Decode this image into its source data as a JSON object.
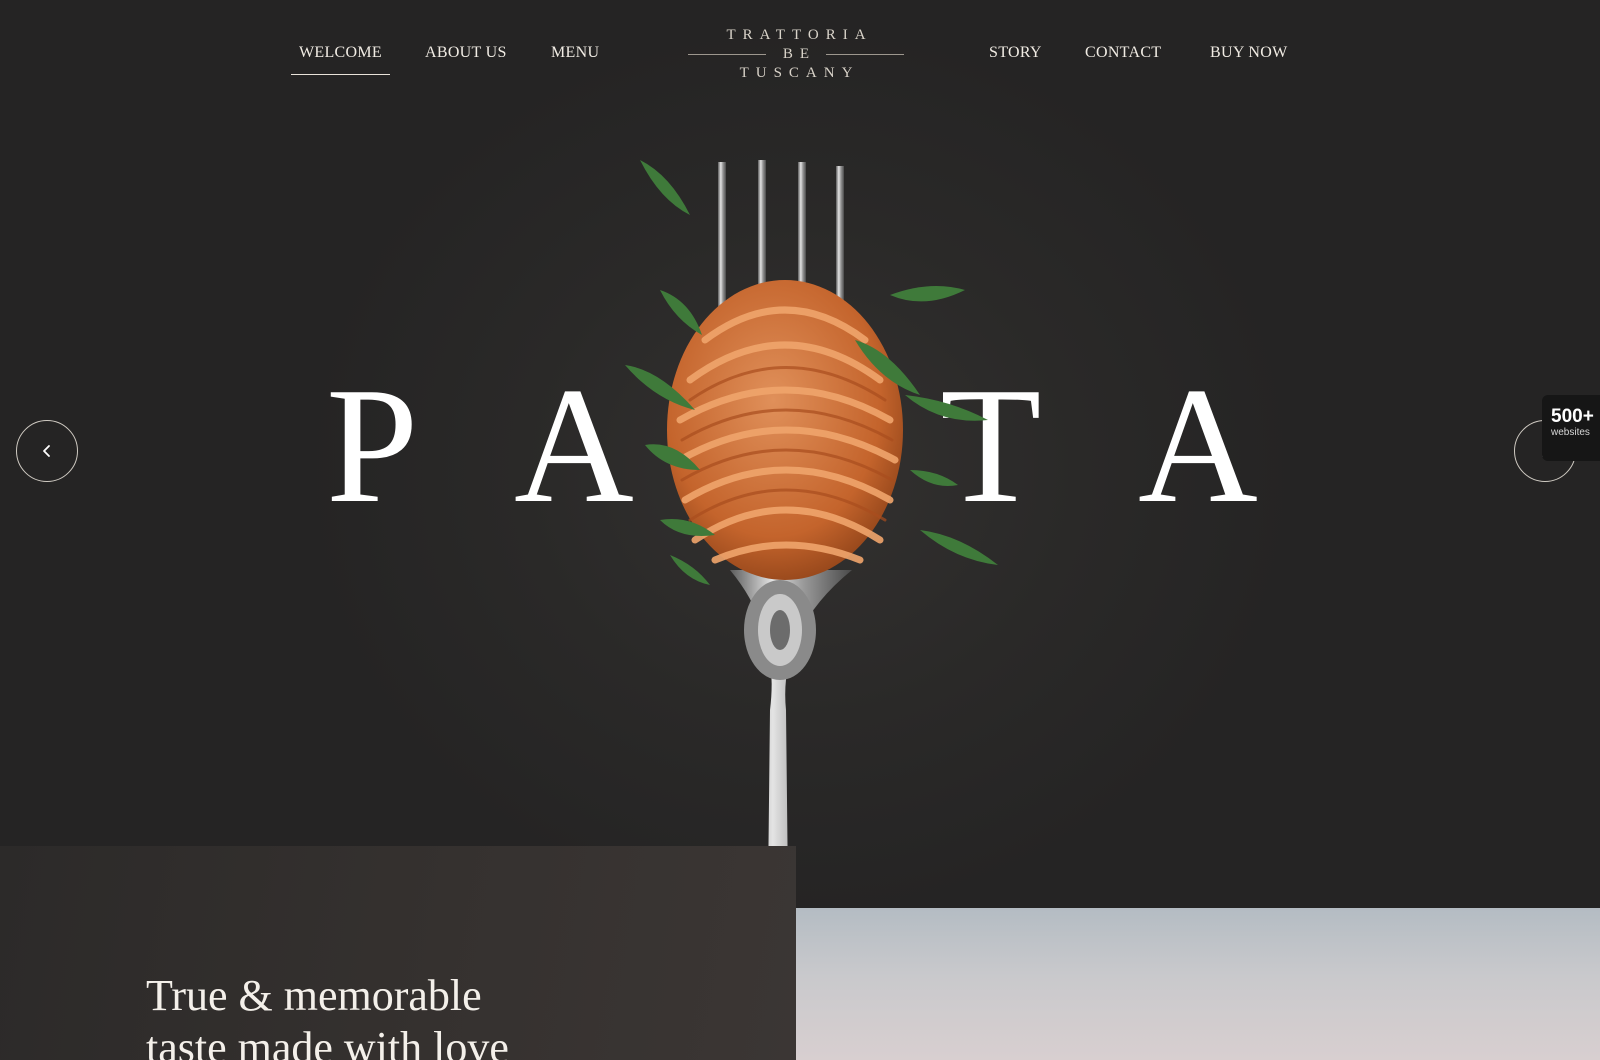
{
  "nav": {
    "left_items": [
      {
        "label": "WELCOME",
        "active": true
      },
      {
        "label": "ABOUT US",
        "active": false
      },
      {
        "label": "MENU",
        "active": false
      }
    ],
    "right_items": [
      {
        "label": "STORY"
      },
      {
        "label": "CONTACT"
      },
      {
        "label": "BUY NOW"
      }
    ]
  },
  "logo": {
    "line1": "TRATTORIA",
    "line2": "BE",
    "line3": "TUSCANY"
  },
  "hero": {
    "letters": [
      "P",
      "A",
      "T",
      "A"
    ],
    "image_icon": "fork-with-pasta-icon"
  },
  "slider": {
    "prev_icon": "chevron-left-icon",
    "next_icon": "chevron-right-icon"
  },
  "badge": {
    "count": "500+",
    "label": "websites"
  },
  "intro": {
    "tagline_line1": "True & memorable",
    "tagline_line2": "taste made with love"
  },
  "colors": {
    "background": "#262525",
    "text": "#f1ece4",
    "badge_bg": "#161616"
  }
}
